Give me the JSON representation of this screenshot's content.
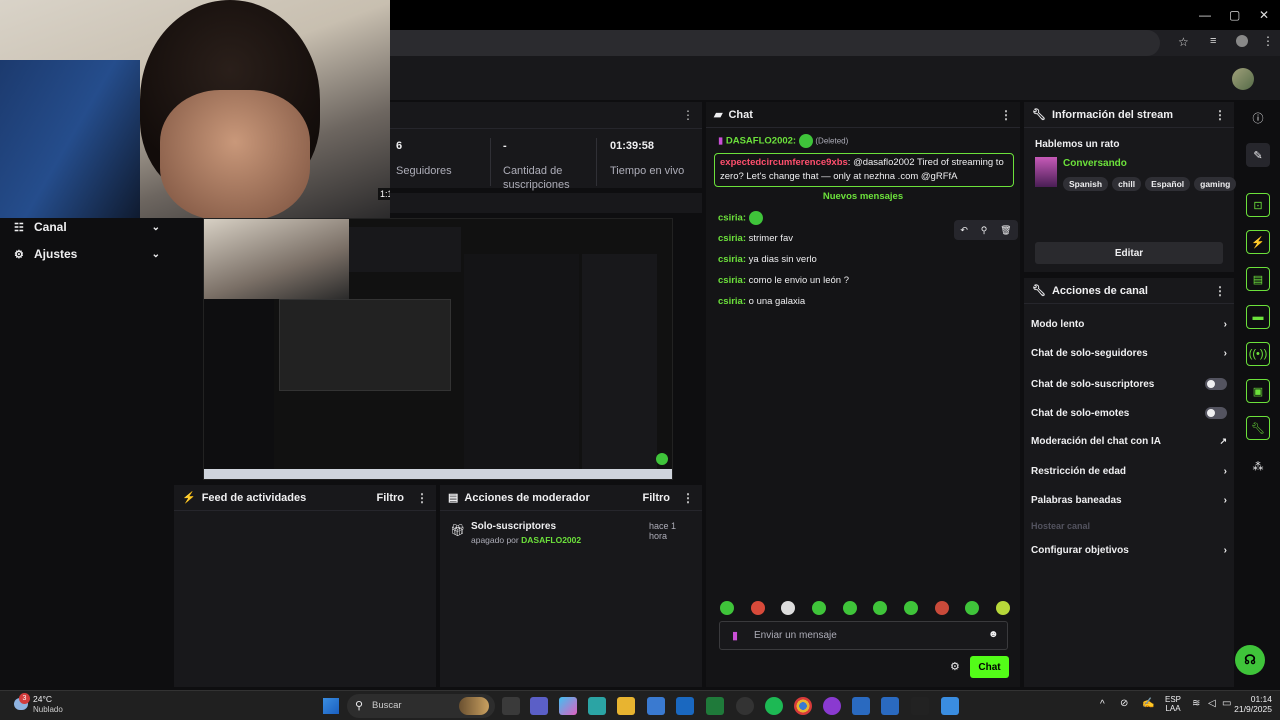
{
  "browser": {
    "title_controls": [
      "—",
      "▢",
      "✕"
    ]
  },
  "stats": [
    {
      "value": "6",
      "label": "Seguidores"
    },
    {
      "value": "-",
      "label": "Cantidad de suscripciones"
    },
    {
      "value": "01:39:58",
      "label": "Tiempo en vivo"
    }
  ],
  "webcam_overlay": "1:1",
  "nav": [
    {
      "label": "Canal"
    },
    {
      "label": "Ajustes"
    }
  ],
  "activity_feed": {
    "title": "Feed de actividades",
    "filter": "Filtro"
  },
  "mod_actions": {
    "title": "Acciones de moderador",
    "filter": "Filtro",
    "items": [
      {
        "title": "Solo-suscriptores",
        "time": "hace 1 hora",
        "prefix": "apagado por",
        "user": "DASAFLO2002"
      }
    ]
  },
  "chat": {
    "title": "Chat",
    "pinned_user": "DASAFLO2002:",
    "deleted": "(Deleted)",
    "highlight_user": "expectedcircumference9xbs",
    "highlight_text": ": @dasaflo2002 Tired of streaming to zero? Let's change that — only at nezhna .com @gRFfA",
    "new_messages": "Nuevos mensajes",
    "messages": [
      {
        "user": "csiria:",
        "text": ""
      },
      {
        "user": "csiria:",
        "text": "strimer fav"
      },
      {
        "user": "csiria:",
        "text": "ya dias sin verlo"
      },
      {
        "user": "csiria:",
        "text": "como le envio un león ?"
      },
      {
        "user": "csiria:",
        "text": "o una galaxia"
      }
    ],
    "input_placeholder": "Enviar un mensaje",
    "send_label": "Chat"
  },
  "stream_info": {
    "title": "Información del stream",
    "stream_title": "Hablemos un rato",
    "category": "Conversando",
    "tags": [
      "Spanish",
      "chill",
      "Español",
      "gaming"
    ],
    "edit_label": "Editar"
  },
  "channel_actions": {
    "title": "Acciones de canal",
    "items": [
      {
        "label": "Modo lento",
        "control": "chevron"
      },
      {
        "label": "Chat de solo-seguidores",
        "control": "chevron"
      },
      {
        "label": "Chat de solo-suscriptores",
        "control": "toggle"
      },
      {
        "label": "Chat de solo-emotes",
        "control": "toggle"
      },
      {
        "label": "Moderación del chat con IA",
        "control": "chart"
      },
      {
        "label": "Restricción de edad",
        "control": "chevron"
      },
      {
        "label": "Palabras baneadas",
        "control": "chevron"
      },
      {
        "label": "Hostear canal",
        "control": "none",
        "disabled": true
      },
      {
        "label": "Configurar objetivos",
        "control": "chevron"
      }
    ]
  },
  "taskbar": {
    "weather_temp": "24°C",
    "weather_desc": "Nublado",
    "weather_badge": "3",
    "search_label": "Buscar",
    "lang": "ESP",
    "lang_sub": "LAA",
    "time": "01:14",
    "date": "21/9/2025"
  },
  "colors": {
    "accent": "#53fc18",
    "bg": "#0e0e10",
    "panel": "#18181b"
  }
}
